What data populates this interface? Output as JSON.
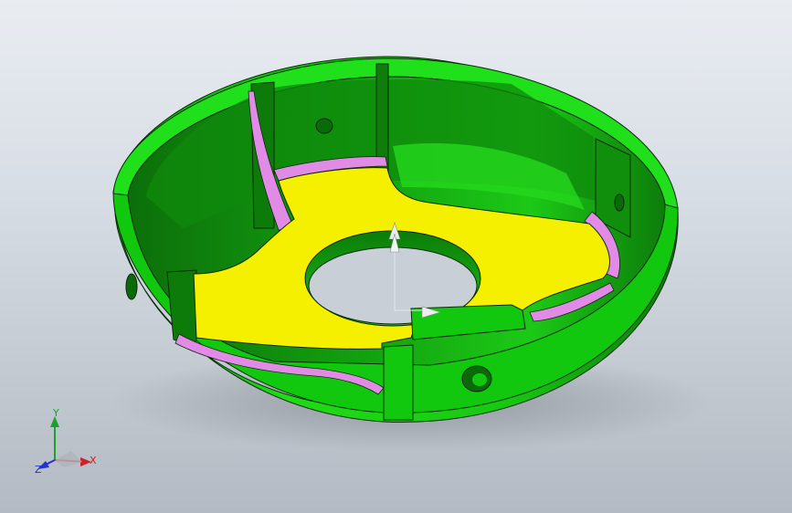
{
  "viewport": {
    "background": "gradient-gray",
    "colors": {
      "part_green": "#12d40f",
      "part_green_dark": "#0a8a08",
      "face_yellow": "#f5f000",
      "fillet_pink": "#e18be6",
      "edge": "#0b2a0b"
    }
  },
  "triad": {
    "x_label": "X",
    "y_label": "Y",
    "z_label": "Z",
    "x_color": "#d0202a",
    "y_color": "#18a32a",
    "z_color": "#2633c8"
  }
}
